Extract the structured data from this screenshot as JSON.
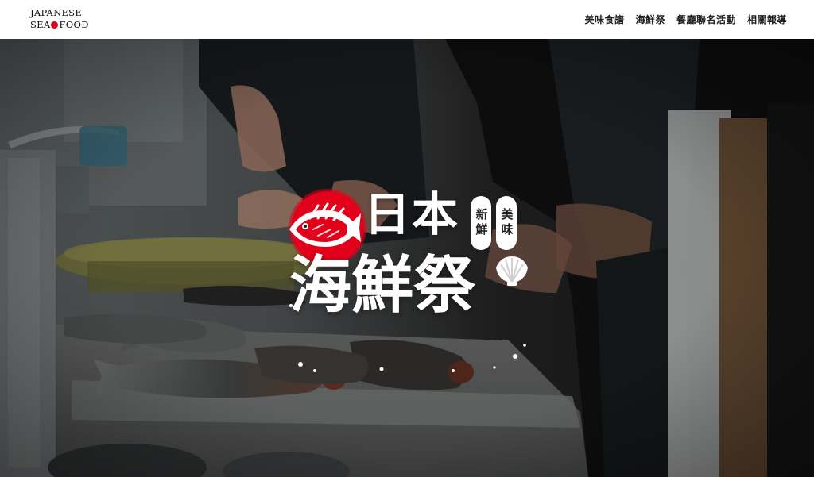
{
  "header": {
    "logo": {
      "line1": "JAPANESE",
      "line2_left": "SEA",
      "line2_right": "FOOD"
    },
    "nav": [
      {
        "label": "美味食譜"
      },
      {
        "label": "海鮮祭"
      },
      {
        "label": "餐廳聯名活動"
      },
      {
        "label": "相關報導"
      }
    ]
  },
  "hero": {
    "title_top": "日本",
    "title_bottom": "海鮮祭",
    "badge_1": "新鮮",
    "badge_2": "美味",
    "icons": [
      "fish-icon",
      "scallop-shell-icon"
    ]
  },
  "colors": {
    "brand_red": "#e2001a",
    "header_bg": "#ffffff",
    "nav_text": "#222222"
  }
}
